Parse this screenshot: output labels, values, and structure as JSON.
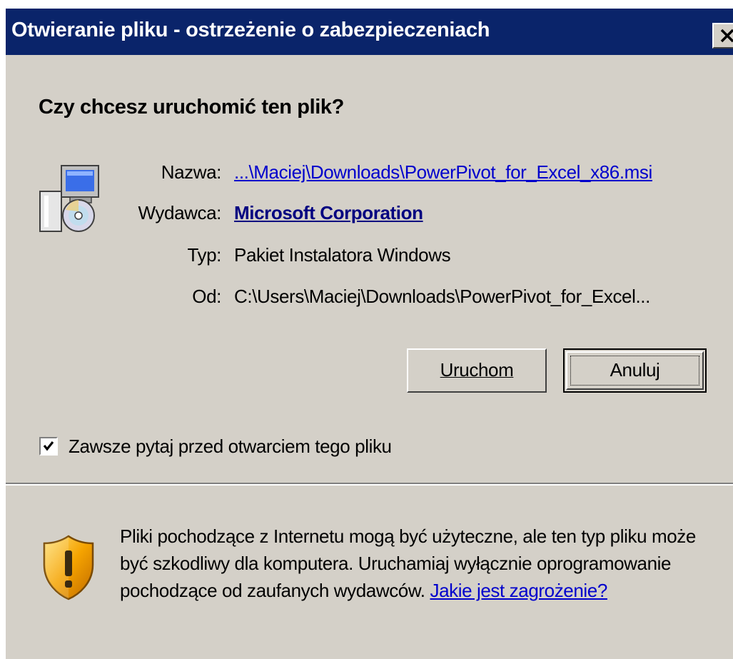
{
  "window": {
    "title": "Otwieranie pliku - ostrzeżenie o zabezpieczeniach"
  },
  "dialog": {
    "question": "Czy chcesz uruchomić ten plik?",
    "fields": {
      "name_label": "Nazwa:",
      "name_value": "...\\Maciej\\Downloads\\PowerPivot_for_Excel_x86.msi",
      "publisher_label": "Wydawca:",
      "publisher_value": "Microsoft Corporation",
      "type_label": "Typ:",
      "type_value": "Pakiet Instalatora Windows",
      "from_label": "Od:",
      "from_value": "C:\\Users\\Maciej\\Downloads\\PowerPivot_for_Excel..."
    },
    "buttons": {
      "run_label": "Uruchom",
      "cancel_label": "Anuluj"
    },
    "checkbox": {
      "label": "Zawsze pytaj przed otwarciem tego pliku",
      "checked": true
    },
    "warning": {
      "text": "Pliki pochodzące z Internetu mogą być użyteczne, ale ten typ pliku może być szkodliwy dla komputera. Uruchamiaj wyłącznie oprogramowanie pochodzące od zaufanych wydawców.",
      "link": "Jakie jest zagrożenie?"
    }
  },
  "icons": {
    "installer": "msi-installer-icon",
    "shield": "warning-shield-icon",
    "close": "close-icon",
    "check": "check-icon"
  },
  "colors": {
    "titlebar": "#0a246a",
    "dialog_bg": "#d4d0c8",
    "link": "#0000cc",
    "link_bold": "#000080"
  }
}
